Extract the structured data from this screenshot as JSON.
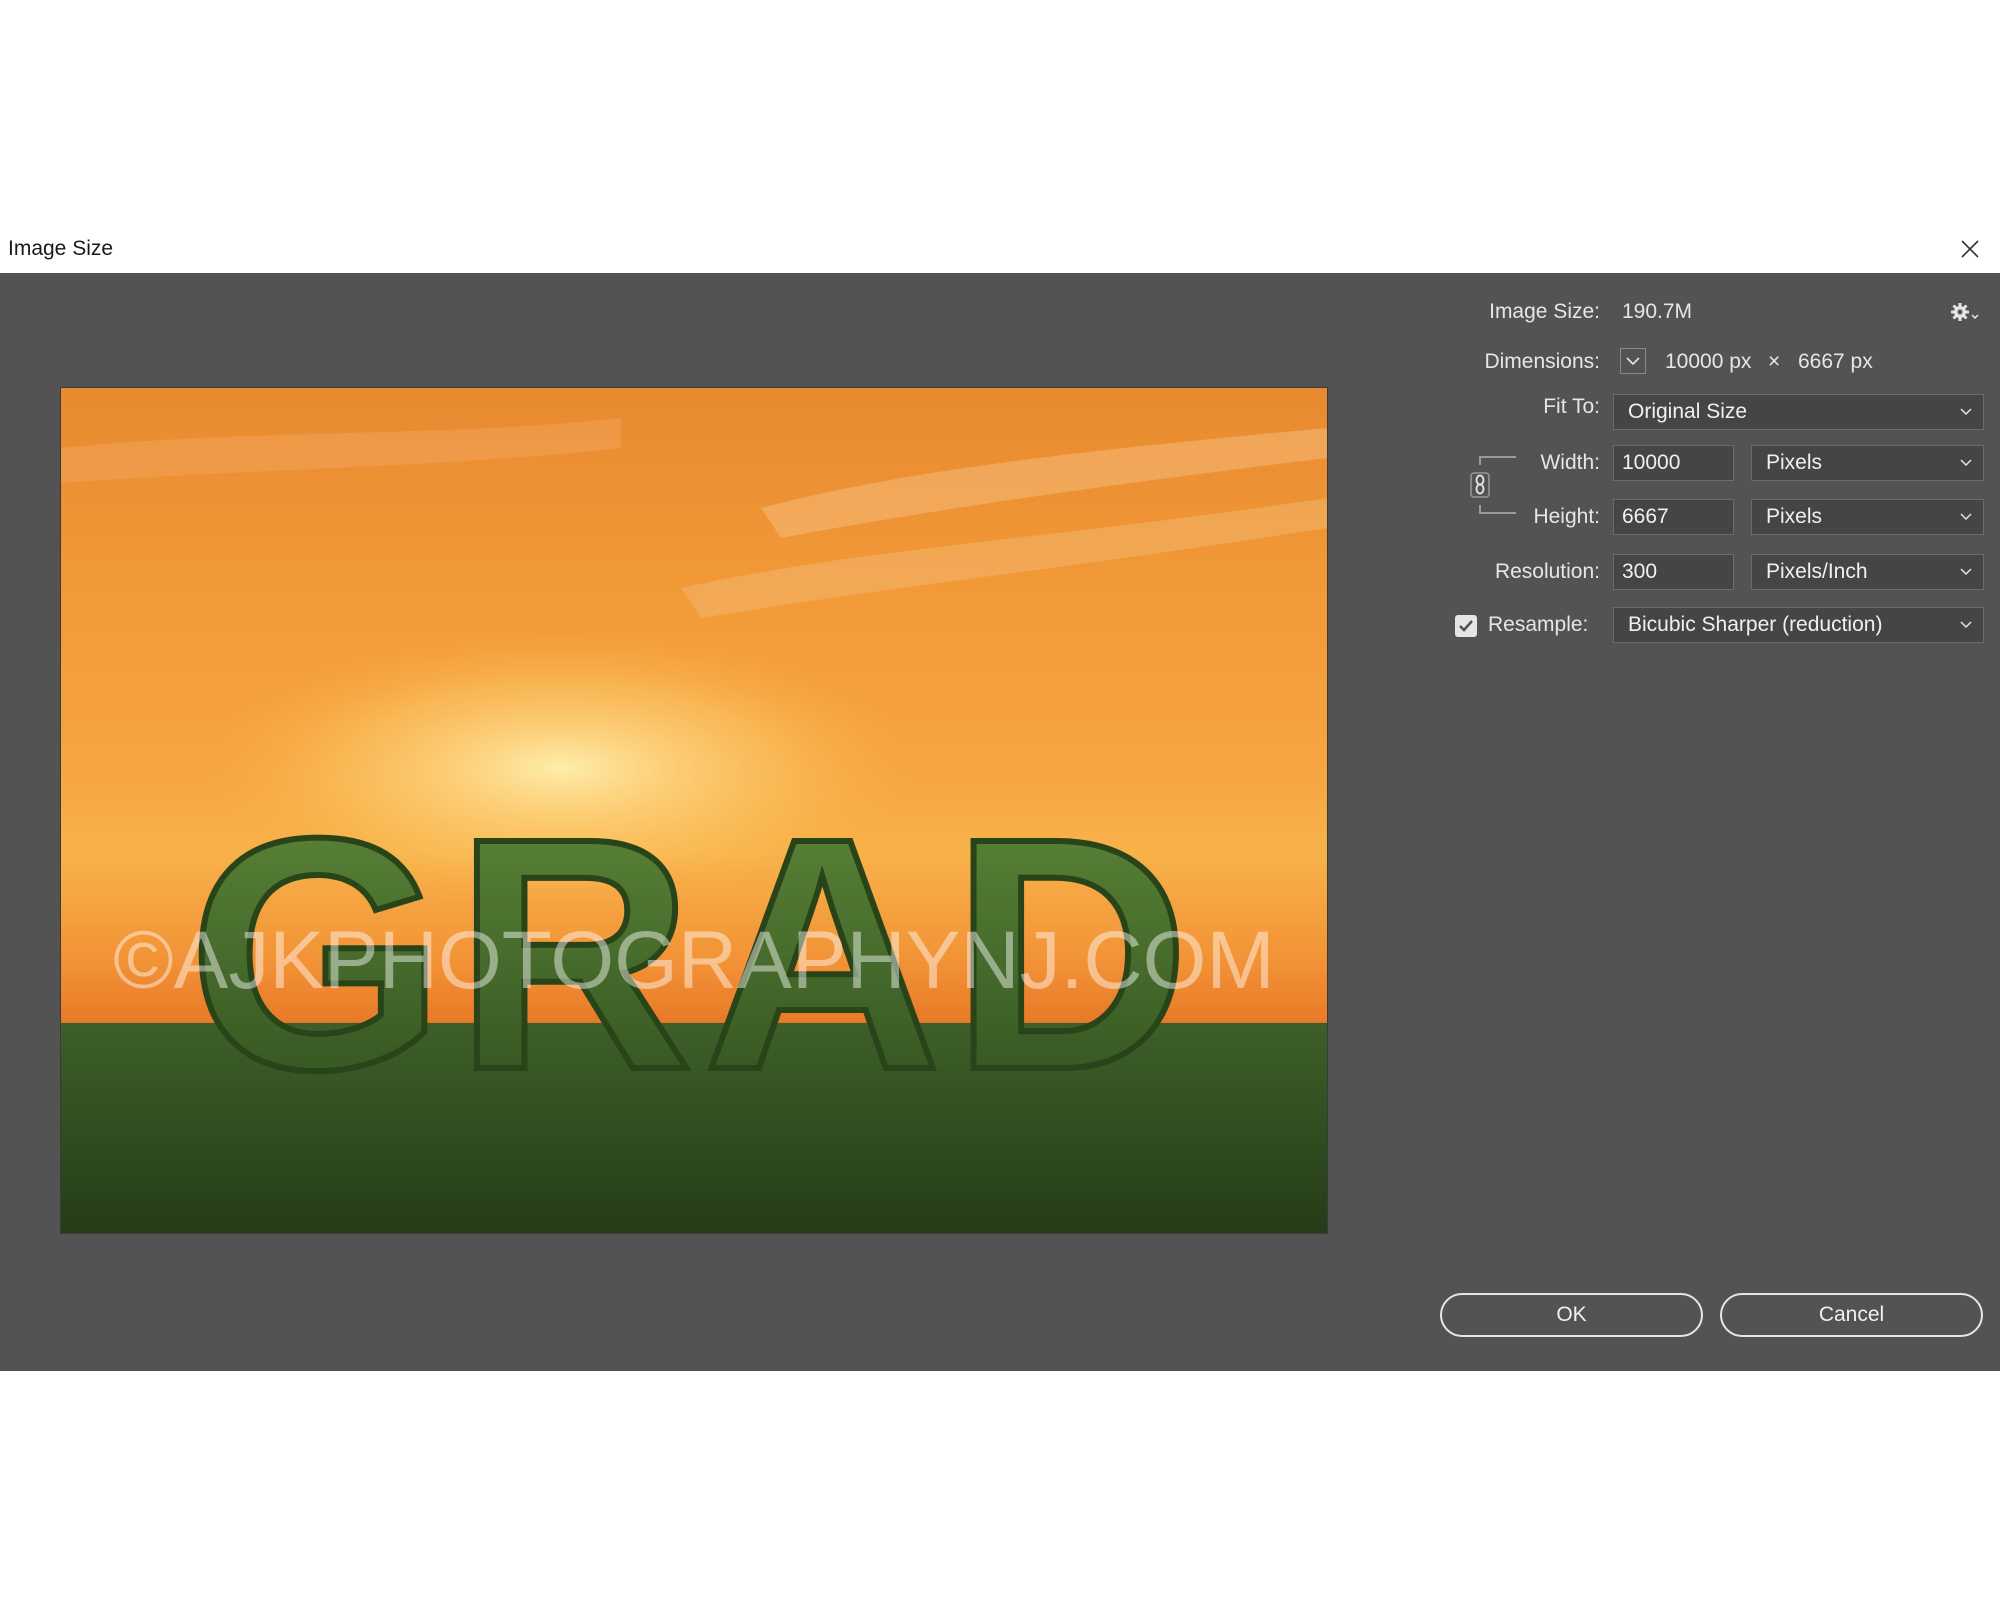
{
  "window": {
    "title": "Image Size"
  },
  "info": {
    "image_size_label": "Image Size:",
    "image_size_value": "190.7M",
    "dimensions_label": "Dimensions:",
    "dim_width": "10000 px",
    "dim_times": "×",
    "dim_height": "6667 px"
  },
  "fit_to": {
    "label": "Fit To:",
    "value": "Original Size"
  },
  "width": {
    "label": "Width:",
    "value": "10000",
    "unit": "Pixels"
  },
  "height": {
    "label": "Height:",
    "value": "6667",
    "unit": "Pixels"
  },
  "resolution": {
    "label": "Resolution:",
    "value": "300",
    "unit": "Pixels/Inch"
  },
  "resample": {
    "label": "Resample:",
    "checked": true,
    "value": "Bicubic Sharper (reduction)"
  },
  "buttons": {
    "ok": "OK",
    "cancel": "Cancel"
  },
  "preview": {
    "main_text": "GRAD",
    "watermark": "©AJKPHOTOGRAPHYNJ.COM"
  },
  "colors": {
    "dialog_bg": "#535353",
    "field_bg": "#454545",
    "text": "#e6e6e6"
  },
  "icons": {
    "close": "close-icon",
    "gear": "gear-icon",
    "chevron": "chevron-down-icon",
    "link": "chain-link-icon",
    "check": "check-icon"
  }
}
